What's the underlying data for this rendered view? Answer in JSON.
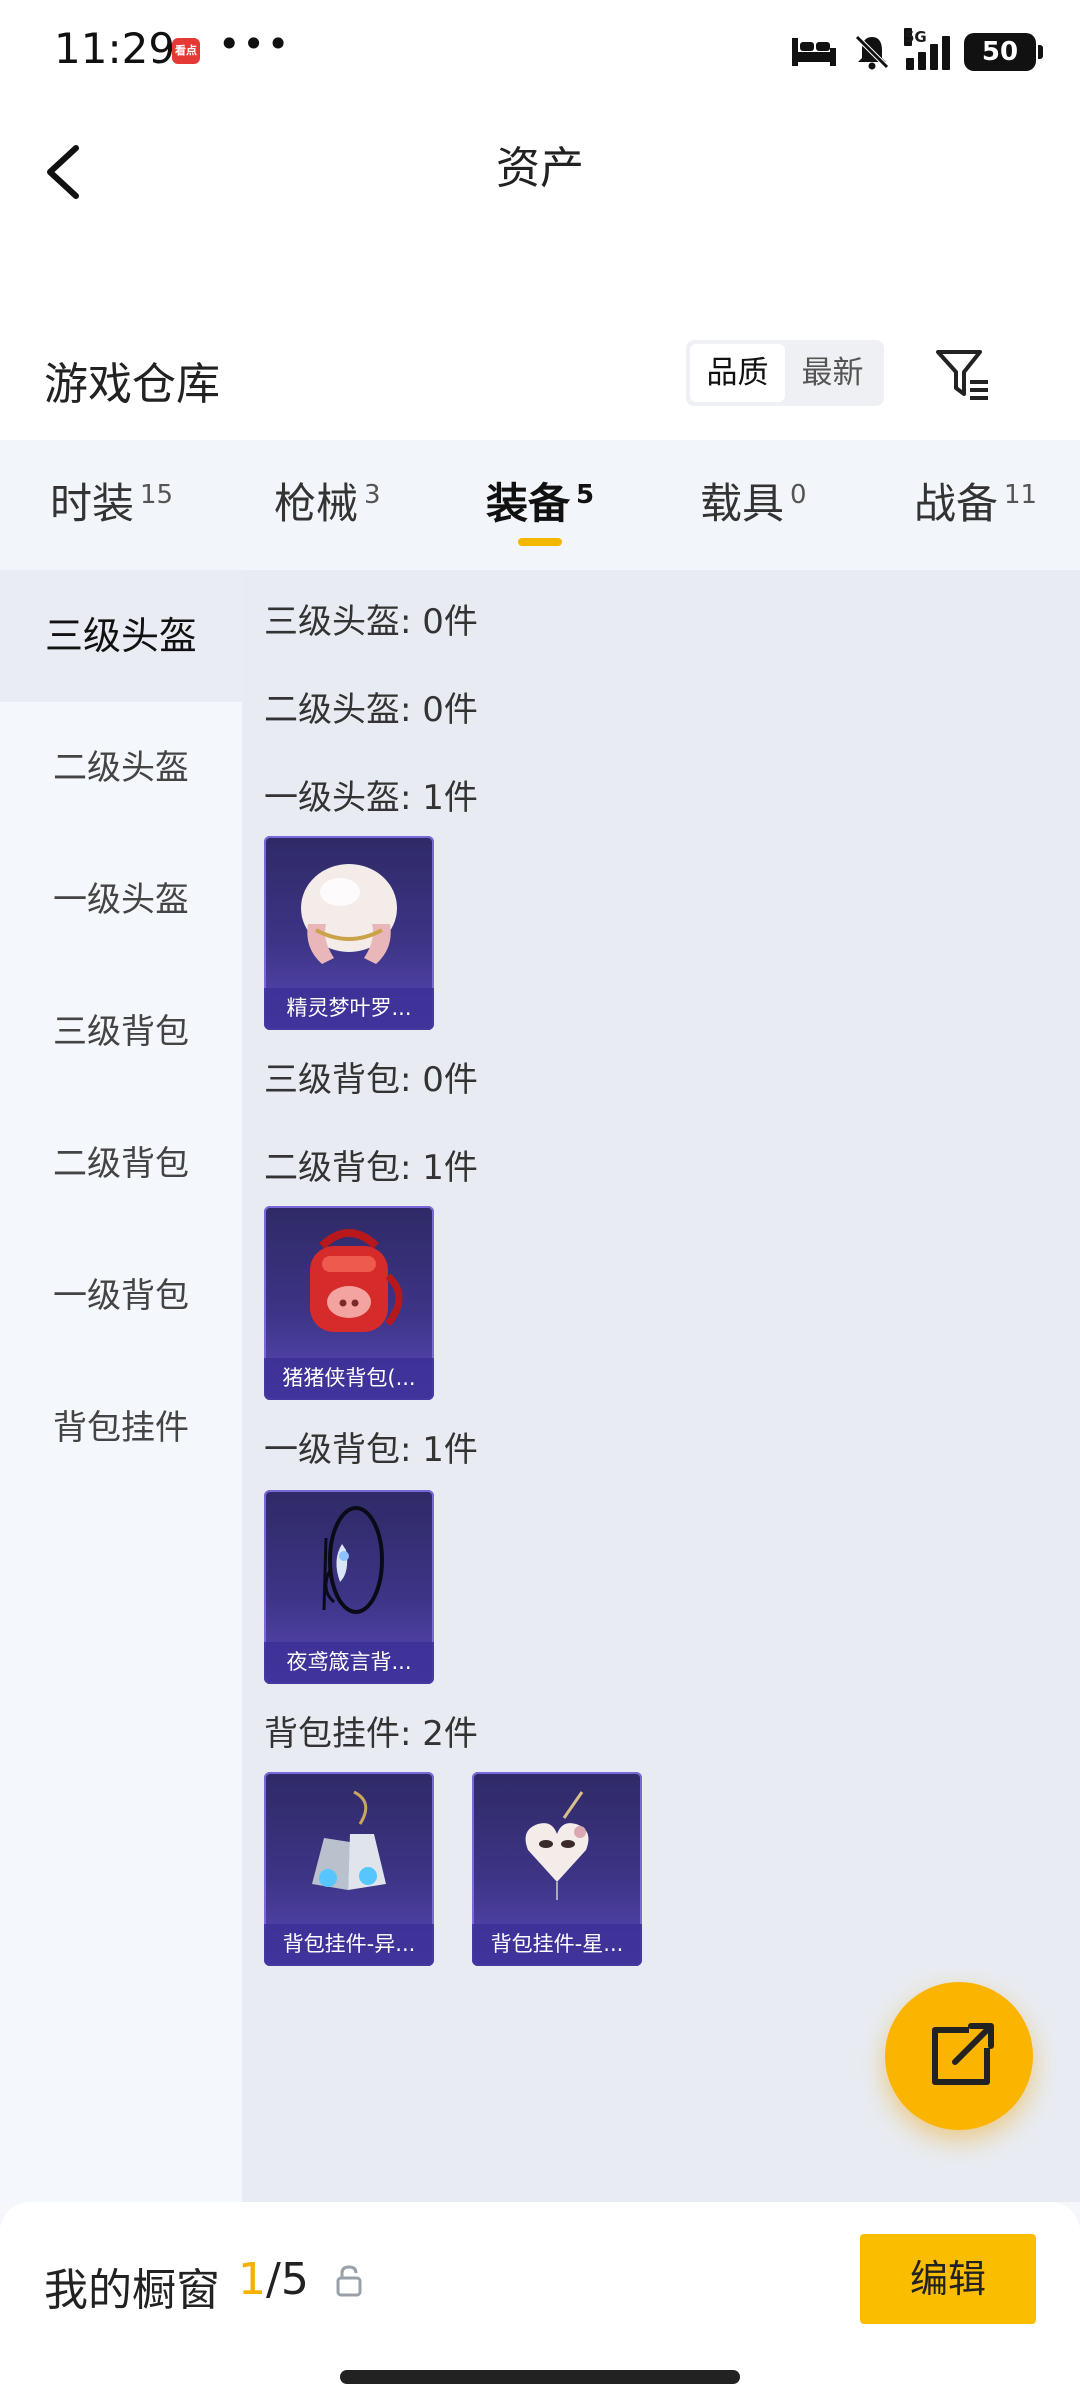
{
  "status_bar": {
    "time": "11:29",
    "app_badge": "看点",
    "dots": "•••",
    "network": "5G",
    "battery": "50"
  },
  "header": {
    "title": "资产",
    "back_icon": "chevron-left-icon"
  },
  "warehouse": {
    "title": "游戏仓库",
    "sort_options": [
      "品质",
      "最新"
    ],
    "sort_selected": "品质",
    "filter_icon": "filter-icon"
  },
  "tabs": [
    {
      "label": "时装",
      "count": "15"
    },
    {
      "label": "枪械",
      "count": "3"
    },
    {
      "label": "装备",
      "count": "5",
      "active": true
    },
    {
      "label": "载具",
      "count": "0"
    },
    {
      "label": "战备",
      "count": "11"
    }
  ],
  "sidebar": {
    "items": [
      "三级头盔",
      "二级头盔",
      "一级头盔",
      "三级背包",
      "二级背包",
      "一级背包",
      "背包挂件"
    ],
    "selected": "三级头盔"
  },
  "sections": [
    {
      "label": "三级头盔: 0件",
      "items": []
    },
    {
      "label": "二级头盔: 0件",
      "items": []
    },
    {
      "label": "一级头盔: 1件",
      "items": [
        {
          "name": "精灵梦叶罗...",
          "art": "helmet-icon"
        }
      ]
    },
    {
      "label": "三级背包: 0件",
      "items": []
    },
    {
      "label": "二级背包: 1件",
      "items": [
        {
          "name": "猪猪侠背包(...",
          "art": "backpack-icon"
        }
      ]
    },
    {
      "label": "一级背包: 1件",
      "items": [
        {
          "name": "夜鸢箴言背...",
          "art": "wire-backpack-icon"
        }
      ]
    },
    {
      "label": "背包挂件: 2件",
      "items": [
        {
          "name": "背包挂件-异...",
          "art": "bell-charm-icon"
        },
        {
          "name": "背包挂件-星...",
          "art": "heart-charm-icon"
        }
      ]
    }
  ],
  "fab": {
    "icon": "share-out-icon"
  },
  "showcase": {
    "label": "我的橱窗",
    "current": "1",
    "total": "/5",
    "lock_icon": "lock-icon",
    "edit_label": "编辑"
  },
  "colors": {
    "accent": "#f5b800",
    "card_bg": "#3d3486",
    "content_bg": "#e8ecf2"
  }
}
